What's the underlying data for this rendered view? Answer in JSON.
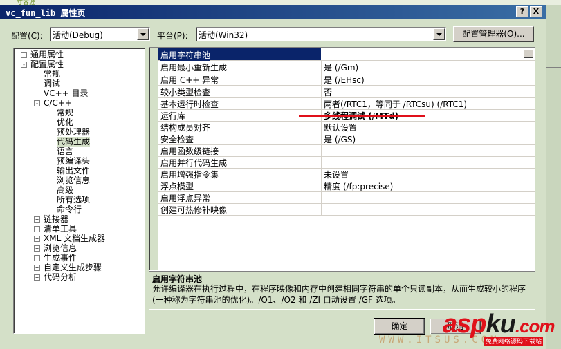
{
  "window": {
    "title": "vc_fun_lib 属性页",
    "help_btn": "?",
    "close_btn": "X",
    "top_fragment": "寸容涯"
  },
  "toolbar": {
    "config_label": "配置(C):",
    "config_value": "活动(Debug)",
    "platform_label": "平台(P):",
    "platform_value": "活动(Win32)",
    "config_manager_btn": "配置管理器(O)..."
  },
  "tree": {
    "toggles": {
      "collapsed": "+",
      "expanded": "-"
    },
    "items": [
      {
        "label": "通用属性"
      },
      {
        "label": "配置属性"
      },
      {
        "label": "常规"
      },
      {
        "label": "调试"
      },
      {
        "label": "VC++ 目录"
      },
      {
        "label": "C/C++"
      },
      {
        "label": "常规"
      },
      {
        "label": "优化"
      },
      {
        "label": "预处理器"
      },
      {
        "label": "代码生成"
      },
      {
        "label": "语言"
      },
      {
        "label": "预编译头"
      },
      {
        "label": "输出文件"
      },
      {
        "label": "浏览信息"
      },
      {
        "label": "高级"
      },
      {
        "label": "所有选项"
      },
      {
        "label": "命令行"
      },
      {
        "label": "链接器"
      },
      {
        "label": "清单工具"
      },
      {
        "label": "XML 文档生成器"
      },
      {
        "label": "浏览信息"
      },
      {
        "label": "生成事件"
      },
      {
        "label": "自定义生成步骤"
      },
      {
        "label": "代码分析"
      }
    ]
  },
  "grid": {
    "rows": [
      {
        "name": "启用字符串池",
        "value": ""
      },
      {
        "name": "启用最小重新生成",
        "value": "是 (/Gm)"
      },
      {
        "name": "启用 C++ 异常",
        "value": "是 (/EHsc)"
      },
      {
        "name": "较小类型检查",
        "value": "否"
      },
      {
        "name": "基本运行时检查",
        "value": "两者(/RTC1，等同于 /RTCsu) (/RTC1)"
      },
      {
        "name": "运行库",
        "value": "多线程调试 (/MTd)"
      },
      {
        "name": "结构成员对齐",
        "value": "默认设置"
      },
      {
        "name": "安全检查",
        "value": "是 (/GS)"
      },
      {
        "name": "启用函数级链接",
        "value": ""
      },
      {
        "name": "启用并行代码生成",
        "value": ""
      },
      {
        "name": "启用增强指令集",
        "value": "未设置"
      },
      {
        "name": "浮点模型",
        "value": "精度 (/fp:precise)"
      },
      {
        "name": "启用浮点异常",
        "value": ""
      },
      {
        "name": "创建可热修补映像",
        "value": ""
      }
    ]
  },
  "description": {
    "heading": "启用字符串池",
    "text": "允许编译器在执行过程中，在程序映像和内存中创建相同字符串的单个只读副本，从而生成较小的程序(一种称为字符串池的优化)。/O1、/O2 和 /ZI 自动设置 /GF 选项。"
  },
  "buttons": {
    "ok": "确定",
    "cancel": "取消"
  },
  "watermark": {
    "brand_a": "asp",
    "brand_k": "ku",
    "brand_c": ".com",
    "url": "WWW.ITSUS.COM",
    "sub": "免费网络源码下载站"
  },
  "colors": {
    "title_bar": "#0a246a",
    "dialog_bg": "#d4e0c8",
    "highlight": "#0a246a",
    "annotation_red": "#e0101a"
  }
}
